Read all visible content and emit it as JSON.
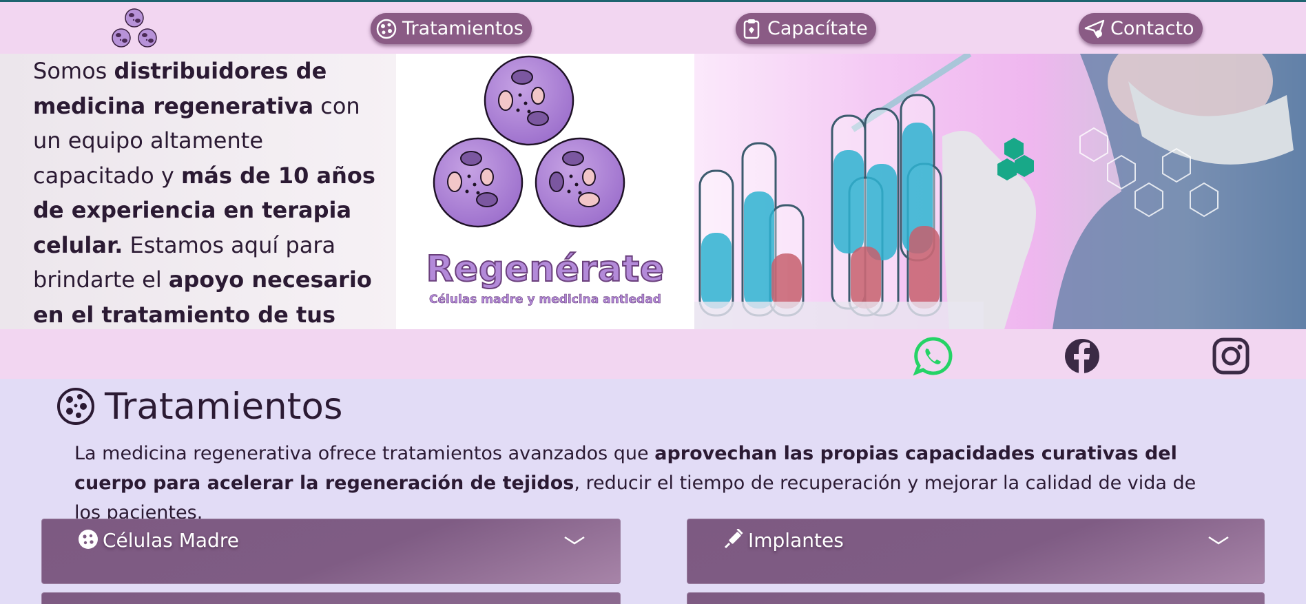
{
  "nav": {
    "logo": "cells-logo-icon",
    "items": [
      {
        "label": "Tratamientos",
        "icon": "cells-icon"
      },
      {
        "label": "Capacítate",
        "icon": "clipboard-icon"
      },
      {
        "label": "Contacto",
        "icon": "paper-plane-icon"
      }
    ]
  },
  "hero": {
    "p1": "Somos ",
    "b1": "distribuidores de medicina regenerativa",
    "p2": " con un equipo altamente capacitado y ",
    "b2": "más de 10 años de experiencia en terapia celular.",
    "p3": " Estamos aquí para brindarte el ",
    "b3": "apoyo necesario en el tratamiento de tus pacientes.",
    "brand": "Regenérate",
    "tagline": "Células madre y medicina antiedad"
  },
  "social": {
    "items": [
      {
        "icon": "whatsapp-icon",
        "color": "#25d366"
      },
      {
        "icon": "facebook-icon",
        "color": "#3b2a45"
      },
      {
        "icon": "instagram-icon",
        "color": "#3b2a45"
      }
    ]
  },
  "treatments": {
    "title": "Tratamientos",
    "d1": "La medicina regenerativa ofrece tratamientos avanzados que ",
    "b1": "aprovechan las propias capacidades curativas del cuerpo para acelerar la regeneración de tejidos",
    "d2": ", reducir el tiempo de recuperación y mejorar la calidad de vida de los pacientes.",
    "cards": [
      {
        "label": "Células Madre",
        "icon": "cells-icon"
      },
      {
        "label": "Implantes",
        "icon": "syringe-icon"
      }
    ]
  },
  "colors": {
    "accent": "#8a5b85",
    "nav_bg": "#f2d6f1",
    "section_bg": "#e2dcf6"
  }
}
